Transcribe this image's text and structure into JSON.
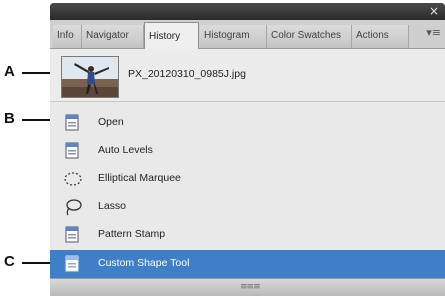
{
  "callouts": {
    "a": "A",
    "b": "B",
    "c": "C"
  },
  "window": {
    "close_glyph": "×",
    "menu_glyph": "▾≡"
  },
  "tabs": [
    "Info",
    "Navigator",
    "History",
    "Histogram",
    "Color Swatches",
    "Actions"
  ],
  "active_tab": "History",
  "snapshot": {
    "name": "PX_20120310_0985J.jpg",
    "thumbnail": "photo-thumbnail"
  },
  "history_items": [
    {
      "label": "Open",
      "icon": "document-icon"
    },
    {
      "label": "Auto Levels",
      "icon": "document-icon"
    },
    {
      "label": "Elliptical Marquee",
      "icon": "elliptical-marquee-icon"
    },
    {
      "label": "Lasso",
      "icon": "lasso-icon"
    },
    {
      "label": "Pattern Stamp",
      "icon": "document-icon"
    },
    {
      "label": "Custom Shape Tool",
      "icon": "document-icon",
      "selected": true
    }
  ],
  "colors": {
    "selection": "#3f7fc7",
    "panel_bg": "#e9e9e9",
    "chrome": "#1f1f1f"
  },
  "bottom_grip": "≡≡≡"
}
